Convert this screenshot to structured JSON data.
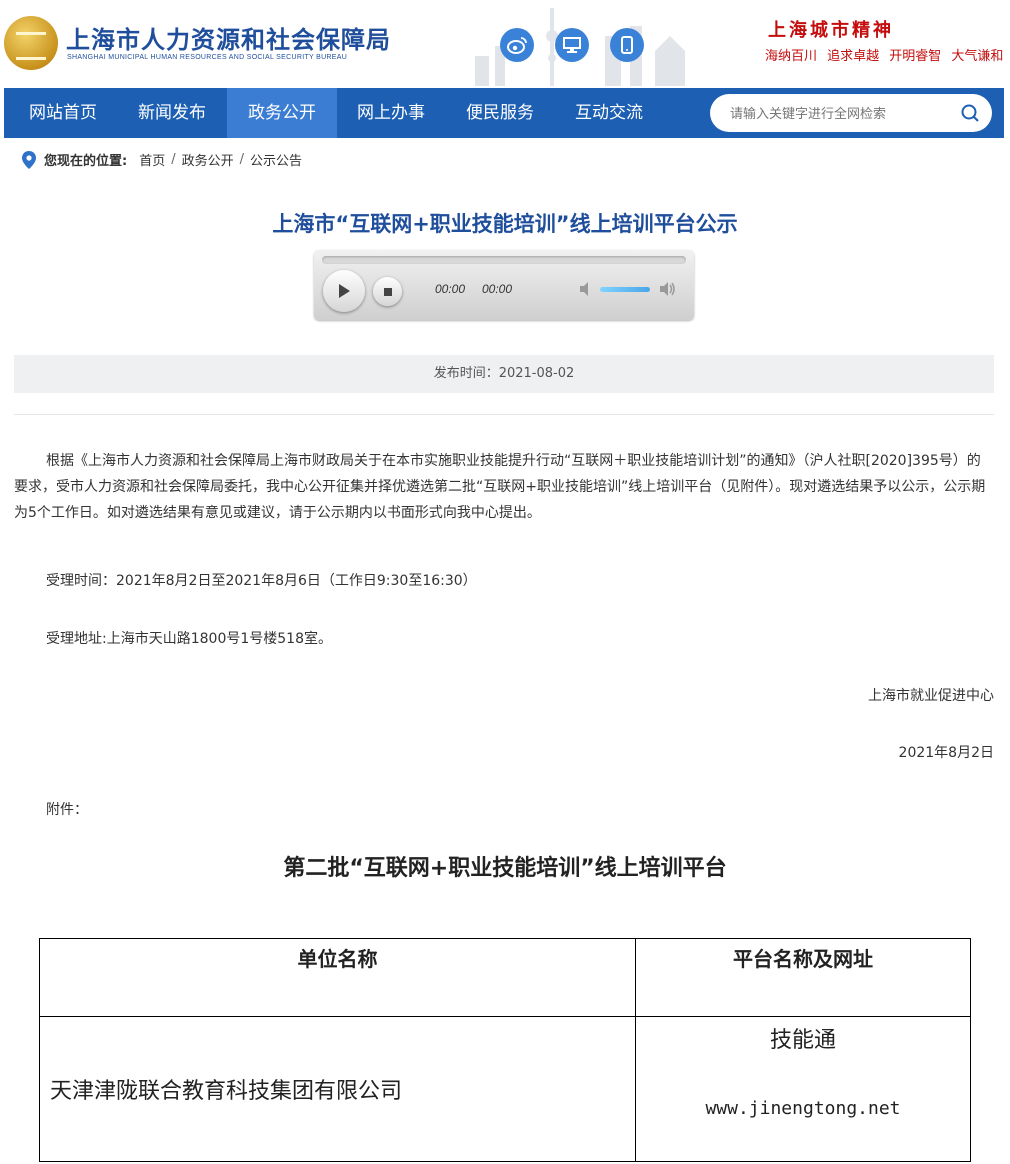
{
  "header": {
    "title": "上海市人力资源和社会保障局",
    "subtitle": "SHANGHAI MUNICIPAL HUMAN RESOURCES AND SOCIAL SECURITY BUREAU",
    "spirit_title": "上海城市精神",
    "spirit_words": "海纳百川 追求卓越 开明睿智 大气谦和",
    "social_icons": [
      "weibo-icon",
      "desktop-icon",
      "mobile-icon"
    ]
  },
  "nav": {
    "items": [
      "网站首页",
      "新闻发布",
      "政务公开",
      "网上办事",
      "便民服务",
      "互动交流"
    ],
    "active": "政务公开",
    "search_placeholder": "请输入关键字进行全网检索"
  },
  "breadcrumb": {
    "label": "您现在的位置:",
    "items": [
      "首页",
      "政务公开",
      "公示公告"
    ]
  },
  "article": {
    "title": "上海市“互联网+职业技能培训”线上培训平台公示",
    "player": {
      "current_time": "00:00",
      "duration": "00:00"
    },
    "publish": "发布时间：2021-08-02",
    "body": "根据《上海市人力资源和社会保障局上海市财政局关于在本市实施职业技能提升行动“互联网＋职业技能培训计划”的通知》（沪人社职[2020]395号）的要求，受市人力资源和社会保障局委托，我中心公开征集并择优遴选第二批“互联网+职业技能培训”线上培训平台（见附件）。现对遴选结果予以公示，公示期为5个工作日。如对遴选结果有意见或建议，请于公示期内以书面形式向我中心提出。",
    "time": "受理时间：2021年8月2日至2021年8月6日（工作日9:30至16:30）",
    "address": "受理地址:上海市天山路1800号1号楼518室。",
    "org": "上海市就业促进中心",
    "date": "2021年8月2日",
    "attach": "附件："
  },
  "table": {
    "title": "第二批“互联网+职业技能培训”线上培训平台",
    "headers": [
      "单位名称",
      "平台名称及网址"
    ],
    "rows": [
      {
        "unit": "天津津陇联合教育科技集团有限公司",
        "platform": "技能通",
        "url": "www.jinengtong.net"
      }
    ]
  },
  "colors": {
    "nav_bg": "#1c5fb3",
    "nav_active": "#3b7dd2",
    "title_blue": "#1f4e9c",
    "spirit_red": "#c40d0d"
  }
}
